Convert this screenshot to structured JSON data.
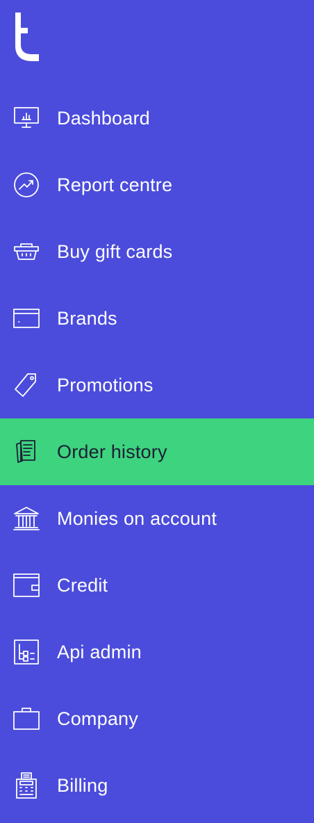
{
  "brand": {
    "logo_icon": "t-logo-icon"
  },
  "colors": {
    "sidebar_background": "#4b4cdb",
    "active_background": "#3dd37f",
    "text": "#ffffff",
    "active_text": "#1d1f33"
  },
  "menu": {
    "active_item": "Order history",
    "items": [
      {
        "label": "Dashboard",
        "icon": "presentation-chart-icon"
      },
      {
        "label": "Report centre",
        "icon": "trend-up-circle-icon"
      },
      {
        "label": "Buy gift cards",
        "icon": "shopping-basket-icon"
      },
      {
        "label": "Brands",
        "icon": "card-icon"
      },
      {
        "label": "Promotions",
        "icon": "price-tag-icon"
      },
      {
        "label": "Order history",
        "icon": "receipts-icon"
      },
      {
        "label": "Monies on account",
        "icon": "bank-icon"
      },
      {
        "label": "Credit",
        "icon": "wallet-icon"
      },
      {
        "label": "Api admin",
        "icon": "hierarchy-icon"
      },
      {
        "label": "Company",
        "icon": "briefcase-icon"
      },
      {
        "label": "Billing",
        "icon": "cash-register-icon"
      }
    ]
  }
}
